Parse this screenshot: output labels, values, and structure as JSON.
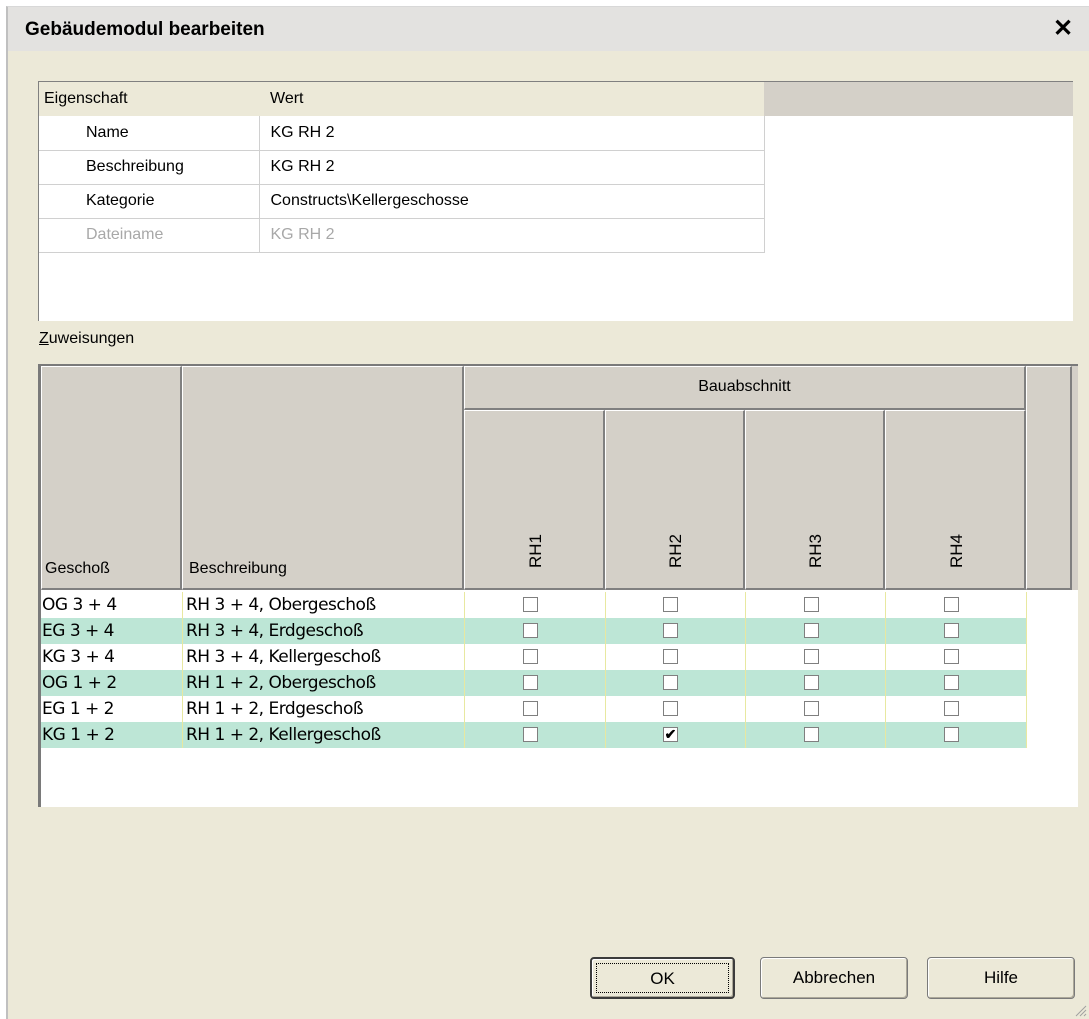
{
  "dialog": {
    "title": "Gebäudemodul bearbeiten"
  },
  "properties": {
    "header": {
      "key": "Eigenschaft",
      "value": "Wert"
    },
    "rows": [
      {
        "key": "Name",
        "value": "KG RH 2",
        "disabled": false
      },
      {
        "key": "Beschreibung",
        "value": "KG RH 2",
        "disabled": false
      },
      {
        "key": "Kategorie",
        "value": "Constructs\\Kellergeschosse",
        "disabled": false
      },
      {
        "key": "Dateiname",
        "value": "KG RH 2",
        "disabled": true
      }
    ]
  },
  "assignments": {
    "label_first": "Z",
    "label_rest": "uweisungen",
    "group_header": "Bauabschnitt",
    "col_floor": "Geschoß",
    "col_desc": "Beschreibung",
    "sections": [
      "RH1",
      "RH2",
      "RH3",
      "RH4"
    ],
    "rows": [
      {
        "floor": "OG 3 + 4",
        "desc": "RH 3 + 4, Obergeschoß",
        "checks": [
          false,
          false,
          false,
          false
        ]
      },
      {
        "floor": "EG 3 + 4",
        "desc": "RH 3 + 4, Erdgeschoß",
        "checks": [
          false,
          false,
          false,
          false
        ]
      },
      {
        "floor": "KG 3 + 4",
        "desc": "RH 3 + 4, Kellergeschoß",
        "checks": [
          false,
          false,
          false,
          false
        ]
      },
      {
        "floor": "OG 1 + 2",
        "desc": "RH 1 + 2, Obergeschoß",
        "checks": [
          false,
          false,
          false,
          false
        ]
      },
      {
        "floor": "EG 1 + 2",
        "desc": "RH 1 + 2, Erdgeschoß",
        "checks": [
          false,
          false,
          false,
          false
        ]
      },
      {
        "floor": "KG 1 + 2",
        "desc": "RH 1 + 2, Kellergeschoß",
        "checks": [
          false,
          true,
          false,
          false
        ]
      }
    ],
    "row_alt_color": "#bde6d6"
  },
  "buttons": {
    "ok": "OK",
    "cancel": "Abbrechen",
    "help": "Hilfe"
  },
  "icons": {
    "close": "close-icon",
    "check": "check-icon",
    "grip": "resize-grip-icon"
  }
}
